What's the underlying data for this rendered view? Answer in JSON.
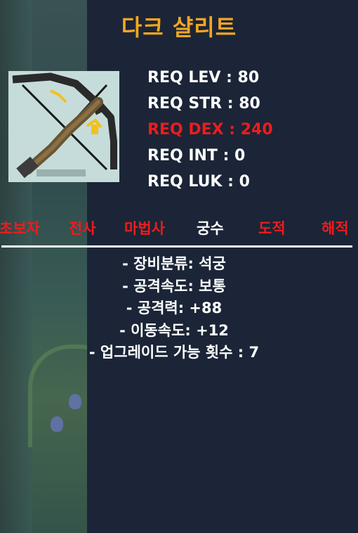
{
  "item": {
    "name": "다크 샬리트",
    "icon": "bow-icon"
  },
  "requirements": [
    {
      "label": "REQ LEV : 80",
      "status": "met"
    },
    {
      "label": "REQ STR : 80",
      "status": "met"
    },
    {
      "label": "REQ DEX : 240",
      "status": "unmet"
    },
    {
      "label": "REQ INT : 0",
      "status": "met"
    },
    {
      "label": "REQ LUK : 0",
      "status": "met"
    }
  ],
  "jobs": [
    {
      "label": "초보자",
      "status": "unavailable"
    },
    {
      "label": "전사",
      "status": "unavailable"
    },
    {
      "label": "마법사",
      "status": "unavailable"
    },
    {
      "label": "궁수",
      "status": "available"
    },
    {
      "label": "도적",
      "status": "unavailable"
    },
    {
      "label": "해적",
      "status": "unavailable"
    }
  ],
  "stats": [
    "- 장비분류: 석궁",
    "- 공격속도: 보통",
    "- 공격력: +88",
    "- 이동속도: +12",
    "- 업그레이드 가능 횟수 : 7"
  ],
  "colors": {
    "title": "#f4a623",
    "unmet": "#ee1c1c",
    "met": "#ffffff",
    "panel": "#1b2537"
  }
}
